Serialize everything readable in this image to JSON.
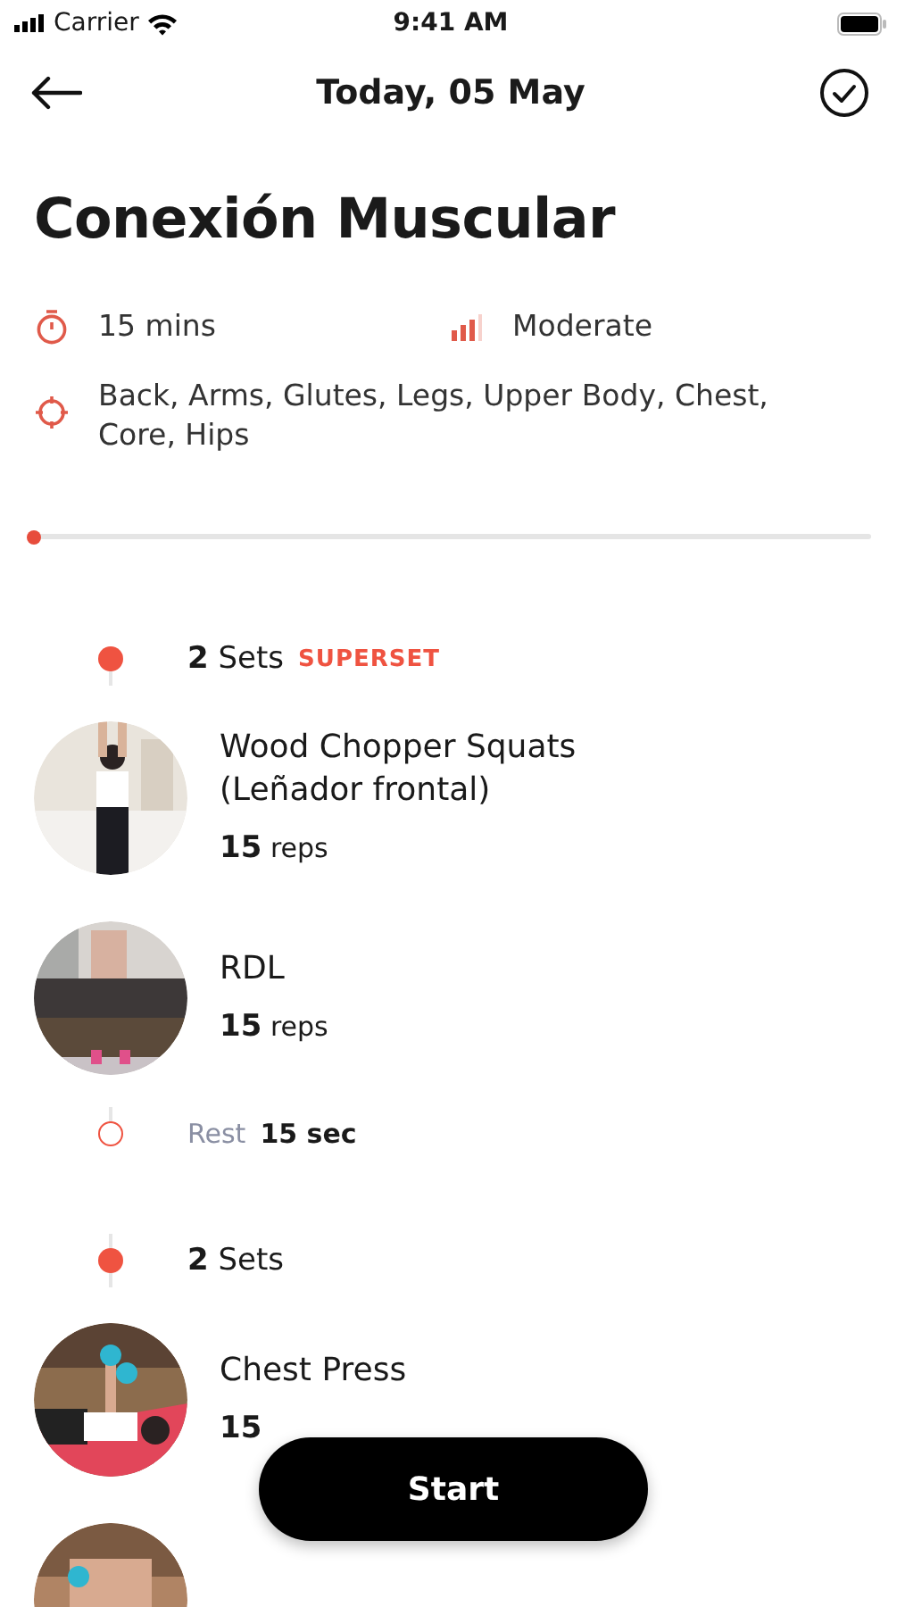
{
  "status_bar": {
    "carrier": "Carrier",
    "time": "9:41 AM"
  },
  "header": {
    "title": "Today, 05 May"
  },
  "workout": {
    "title": "Conexión Muscular",
    "duration": "15 mins",
    "difficulty": "Moderate",
    "targets": "Back, Arms, Glutes, Legs, Upper Body, Chest, Core, Hips"
  },
  "progress": {
    "level": 0
  },
  "blocks": [
    {
      "kind": "sets",
      "sets": "**2** Sets",
      "tag": "SUPERSET",
      "exercises": [
        {
          "kind": "exercise",
          "name": "Wood Chopper Squats (Leñador frontal)",
          "reps": "**15** reps"
        },
        {
          "kind": "exercise",
          "name": "RDL",
          "reps": "**15** reps"
        }
      ]
    },
    {
      "kind": "rest",
      "label": "Rest",
      "value": "15 sec"
    },
    {
      "kind": "sets",
      "sets": "**2** Sets",
      "exercises": [
        {
          "kind": "exercise",
          "name": "Chest Press",
          "reps": "**15**"
        },
        {
          "kind": "picture"
        }
      ]
    }
  ],
  "start_button": "Start"
}
